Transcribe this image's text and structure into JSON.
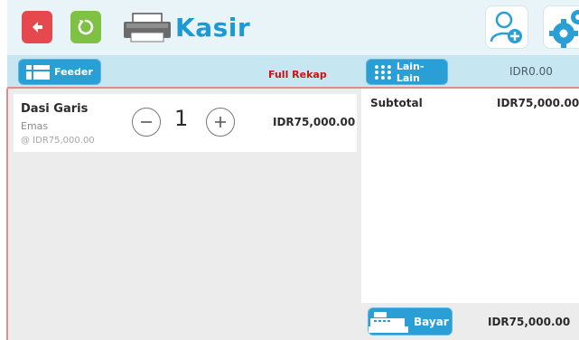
{
  "header": {
    "title": "Kasir",
    "icons": {
      "back": "back-arrow-icon",
      "refresh": "refresh-icon",
      "printer": "printer-icon",
      "add_user": "add-user-icon",
      "settings": "settings-gears-icon"
    }
  },
  "toolbar": {
    "feeder_label": "Feeder",
    "full_rekap_label": "Full Rekap",
    "lain_label": "Lain-Lain",
    "amount": "IDR0.00"
  },
  "cart": {
    "items": [
      {
        "name": "Dasi Garis",
        "variant": "Emas",
        "unit_price": "@ IDR75,000.00",
        "quantity": "1",
        "total": "IDR75,000.00"
      }
    ]
  },
  "summary": {
    "subtotal_label": "Subtotal",
    "subtotal_value": "IDR75,000.00",
    "pay_label": "Bayar",
    "grand_total": "IDR75,000.00"
  },
  "colors": {
    "accent": "#2a9fd6",
    "title": "#1b9ad6",
    "back": "#e5484d",
    "refresh": "#7fc142",
    "full_rekap": "#cc1111"
  }
}
